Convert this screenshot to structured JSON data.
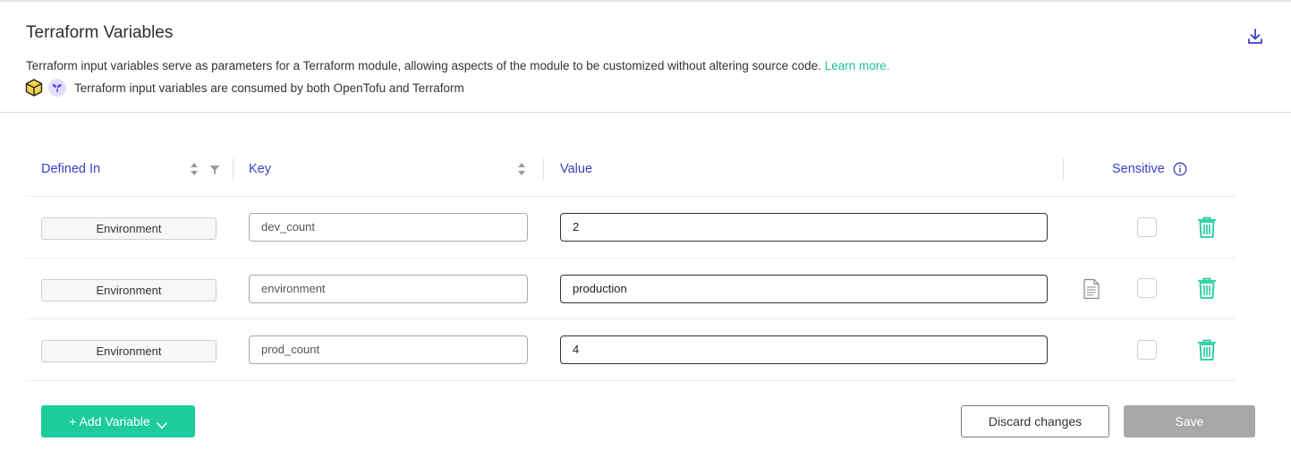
{
  "header": {
    "title": "Terraform Variables",
    "description": "Terraform input variables serve as parameters for a Terraform module, allowing aspects of the module to be customized without altering source code.",
    "learn_more": "Learn more.",
    "engines_note": "Terraform input variables are consumed by both OpenTofu and Terraform",
    "icons": {
      "download": "download-icon",
      "opentofu": "opentofu-logo-icon",
      "terraform": "terraform-logo-icon"
    }
  },
  "table": {
    "columns": {
      "defined_in": "Defined In",
      "key": "Key",
      "value": "Value",
      "sensitive": "Sensitive"
    },
    "rows": [
      {
        "defined_in": "Environment",
        "key": "dev_count",
        "value": "2",
        "sensitive": false,
        "has_doc_icon": false
      },
      {
        "defined_in": "Environment",
        "key": "environment",
        "value": "production",
        "sensitive": false,
        "has_doc_icon": true
      },
      {
        "defined_in": "Environment",
        "key": "prod_count",
        "value": "4",
        "sensitive": false,
        "has_doc_icon": false
      }
    ]
  },
  "footer": {
    "add_variable": "+ Add Variable",
    "discard": "Discard changes",
    "save": "Save"
  },
  "colors": {
    "accent_teal": "#1ecb9c",
    "header_blue": "#3a3fc4",
    "save_disabled": "#a8a8a8"
  }
}
